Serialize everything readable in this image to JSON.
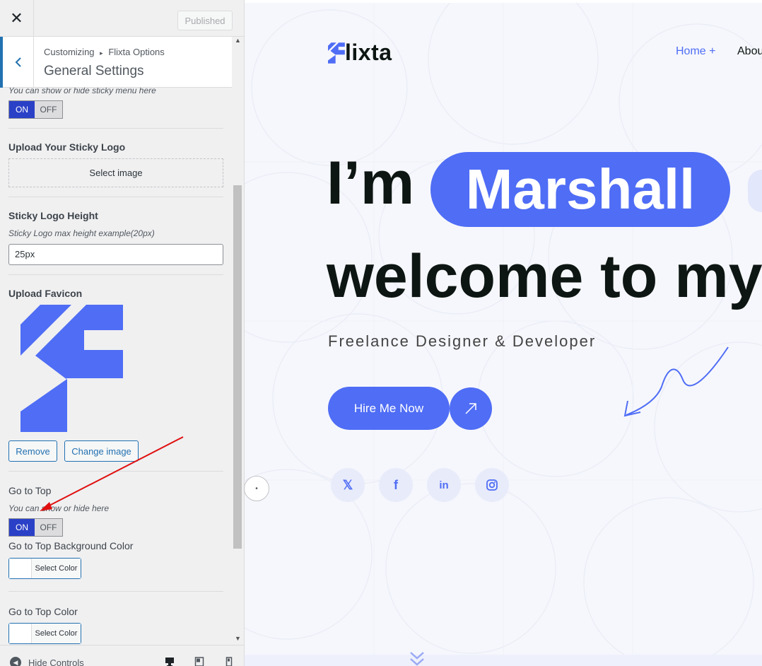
{
  "topbar": {
    "close_label": "✕",
    "published_label": "Published"
  },
  "section": {
    "breadcrumb_root": "Customizing",
    "breadcrumb_sep": "▸",
    "breadcrumb_parent": "Flixta Options",
    "title": "General Settings"
  },
  "sticky_menu": {
    "hint": "You can show or hide sticky menu here",
    "on": "ON",
    "off": "OFF",
    "state": "on"
  },
  "sticky_logo": {
    "label": "Upload Your Sticky Logo",
    "button": "Select image"
  },
  "sticky_logo_height": {
    "label": "Sticky Logo Height",
    "hint": "Sticky Logo max height example(20px)",
    "value": "25px"
  },
  "favicon": {
    "label": "Upload Favicon",
    "remove": "Remove",
    "change": "Change image"
  },
  "go_to_top": {
    "label": "Go to Top",
    "hint": "You can show or hide here",
    "on": "ON",
    "off": "OFF",
    "state": "on"
  },
  "go_to_top_bg": {
    "label": "Go to Top Background Color",
    "button": "Select Color"
  },
  "go_to_top_color": {
    "label": "Go to Top Color",
    "button": "Select Color"
  },
  "footer": {
    "hide_controls": "Hide Controls"
  },
  "preview": {
    "logo_text": "lixta",
    "nav": {
      "home": "Home +",
      "about": "Abou"
    },
    "hero": {
      "prefix": "I’m",
      "name": "Marshall",
      "line2": "welcome to my"
    },
    "subtitle": "Freelance Designer & Developer",
    "cta": "Hire Me Now",
    "social_icons": [
      "x-icon",
      "facebook-icon",
      "linkedin-icon",
      "instagram-icon"
    ]
  },
  "colors": {
    "accent": "#4f6df5",
    "wp_blue": "#2271b1",
    "toggle_on": "#2a40c7",
    "annotation_red": "#e01010"
  }
}
